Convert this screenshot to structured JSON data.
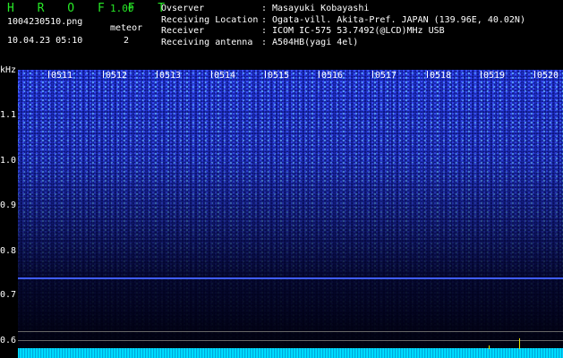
{
  "header": {
    "brand": "H R O F F T",
    "version": "1.00",
    "filename": "1004230510.png",
    "datetime": "10.04.23 05:10",
    "meteor_label": "meteor",
    "meteor_count": "2"
  },
  "info": [
    {
      "key": "Ovserver",
      "value": "Masayuki Kobayashi"
    },
    {
      "key": "Receiving Location",
      "value": "Ogata-vill. Akita-Pref. JAPAN (139.96E, 40.02N)"
    },
    {
      "key": "Receiver",
      "value": "ICOM IC-575 53.7492(@LCD)MHz USB"
    },
    {
      "key": "Receiving antenna",
      "value": "A504HB(yagi 4el)"
    }
  ],
  "spectrogram": {
    "y_unit": "kHz",
    "y_ticks": [
      "1.1",
      "1.0",
      "0.9",
      "0.8",
      "0.7",
      "0.6"
    ],
    "minute_markers": [
      "0511",
      "0512",
      "0513",
      "0514",
      "0515",
      "0516",
      "0517",
      "0518",
      "0519",
      "0520"
    ],
    "colors": {
      "signal": "#0a0f7a",
      "noise": "#00b8e8",
      "spike": "#e8e000",
      "brand": "#27e827"
    }
  }
}
